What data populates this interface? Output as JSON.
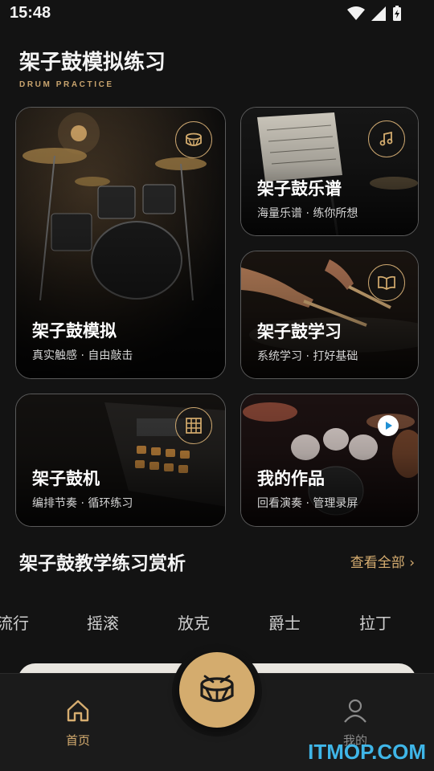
{
  "status_bar": {
    "time": "15:48"
  },
  "header": {
    "title": "架子鼓模拟练习",
    "subtitle": "DRUM PRACTICE"
  },
  "cards": [
    {
      "id": "sim",
      "title": "架子鼓模拟",
      "subtitle": "真实触感 · 自由敲击",
      "icon": "drum-icon"
    },
    {
      "id": "score",
      "title": "架子鼓乐谱",
      "subtitle": "海量乐谱 · 练你所想",
      "icon": "music-note-icon"
    },
    {
      "id": "learn",
      "title": "架子鼓学习",
      "subtitle": "系统学习 · 打好基础",
      "icon": "book-icon"
    },
    {
      "id": "machine",
      "title": "架子鼓机",
      "subtitle": "编排节奏 · 循环练习",
      "icon": "grid-icon"
    },
    {
      "id": "works",
      "title": "我的作品",
      "subtitle": "回看演奏 · 管理录屏",
      "icon": "play-icon"
    }
  ],
  "section": {
    "title": "架子鼓教学练习赏析",
    "see_all": "查看全部 ›"
  },
  "genres": [
    "流行",
    "摇滚",
    "放克",
    "爵士",
    "拉丁"
  ],
  "bottom_nav": {
    "home_label": "首页",
    "me_label": "我的"
  },
  "watermark": "ITMOP.COM",
  "colors": {
    "accent": "#d4ac6e",
    "background": "#131313",
    "card_border": "#5a5a5a"
  }
}
